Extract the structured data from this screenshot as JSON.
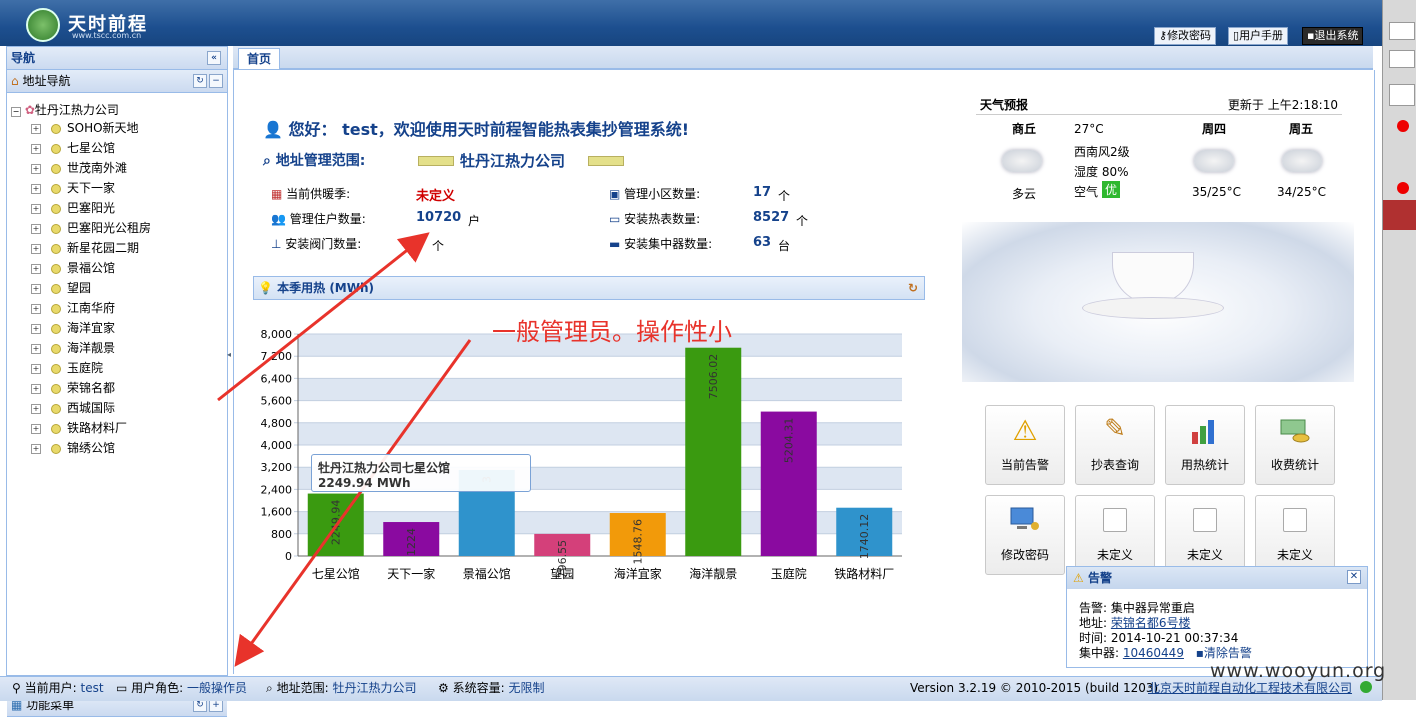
{
  "header": {
    "logo_text": "天时前程",
    "logo_url": "www.tscc.com.cn",
    "buttons": [
      "修改密码",
      "用户手册",
      "退出系统"
    ]
  },
  "sidebar": {
    "title": "导航",
    "section_title": "地址导航",
    "root": "牡丹江热力公司",
    "items": [
      "SOHO新天地",
      "七星公馆",
      "世茂南外滩",
      "天下一家",
      "巴塞阳光",
      "巴塞阳光公租房",
      "新星花园二期",
      "景福公馆",
      "望园",
      "江南华府",
      "海洋宜家",
      "海洋靓景",
      "玉庭院",
      "荣锦名都",
      "西城国际",
      "铁路材料厂",
      "锦绣公馆"
    ],
    "bottom_title": "功能菜单"
  },
  "main": {
    "tab": "首页",
    "greeting": "您好： test，欢迎使用天时前程智能热表集抄管理系统!",
    "scope_label": "地址管理范围:",
    "scope_value": "牡丹江热力公司",
    "stats": {
      "season_label": "当前供暖季:",
      "season_value": "未定义",
      "households_label": "管理住户数量:",
      "households_value": "10720",
      "households_unit": "户",
      "valves_label": "安装阀门数量:",
      "valves_value": "",
      "valves_unit": "个",
      "communities_label": "管理小区数量:",
      "communities_value": "17",
      "communities_unit": "个",
      "meters_label": "安装热表数量:",
      "meters_value": "8527",
      "meters_unit": "个",
      "concentrators_label": "安装集中器数量:",
      "concentrators_value": "63",
      "concentrators_unit": "台"
    },
    "chart_title": "本季用热 (MWh)",
    "annotation": "一般管理员。操作性小",
    "tooltip": {
      "title": "牡丹江热力公司七星公馆",
      "value": "2249.94 MWh"
    }
  },
  "chart_data": {
    "type": "bar",
    "title": "本季用热 (MWh)",
    "categories": [
      "七星公馆",
      "天下一家",
      "景福公馆",
      "望园",
      "海洋宜家",
      "海洋靓景",
      "玉庭院",
      "铁路材料厂"
    ],
    "values": [
      2249.94,
      1224,
      3100,
      796.55,
      1548.76,
      7506.02,
      5204.31,
      1740.12
    ],
    "value_labels": [
      "2249.94",
      "1224",
      "3",
      "796.55",
      "1548.76",
      "7506.02",
      "5204.31",
      "1740.12"
    ],
    "colors": [
      "#3a9a10",
      "#8a0aa0",
      "#2f93cc",
      "#d4407a",
      "#f29a0a",
      "#3a9a10",
      "#8a0aa0",
      "#2f93cc"
    ],
    "yticks": [
      "0",
      "800",
      "1,600",
      "2,400",
      "3,200",
      "4,000",
      "4,800",
      "5,600",
      "6,400",
      "7,200",
      "8,000"
    ],
    "ylim": [
      0,
      8000
    ],
    "grid": true
  },
  "weather": {
    "title": "天气预报",
    "updated": "更新于 上午2:18:10",
    "today": {
      "city": "商丘",
      "temp": "27°C",
      "wind": "西南风2级",
      "humidity": "湿度 80%",
      "air_label": "空气",
      "air_value": "优",
      "desc": "多云"
    },
    "day2": {
      "name": "周四",
      "temp": "35/25°C"
    },
    "day3": {
      "name": "周五",
      "temp": "34/25°C"
    }
  },
  "tiles": [
    "当前告警",
    "抄表查询",
    "用热统计",
    "收费统计",
    "修改密码",
    "未定义",
    "未定义",
    "未定义"
  ],
  "alert": {
    "title": "告警",
    "label1": "告警:",
    "value1": "集中器异常重启",
    "label2": "地址:",
    "value2": "荣锦名都6号楼",
    "label3": "时间:",
    "value3": "2014-10-21 00:37:34",
    "label4": "集中器:",
    "value4": "10460449",
    "clear": "清除告警"
  },
  "status": {
    "user_label": "当前用户:",
    "user": "test",
    "role_label": "用户角色:",
    "role": "一般操作员",
    "scope_label": "地址范围:",
    "scope": "牡丹江热力公司",
    "capacity_label": "系统容量:",
    "capacity": "无限制",
    "version": "Version 3.2.19 © 2010-2015  (build 1203)",
    "company": "北京天时前程自动化工程技术有限公司"
  },
  "watermark": "www.wooyun.org",
  "colors": {
    "accent": "#15428b",
    "header": "#1d4f8f",
    "panel_border": "#99bbe8",
    "annotation_red": "#e8332b"
  }
}
